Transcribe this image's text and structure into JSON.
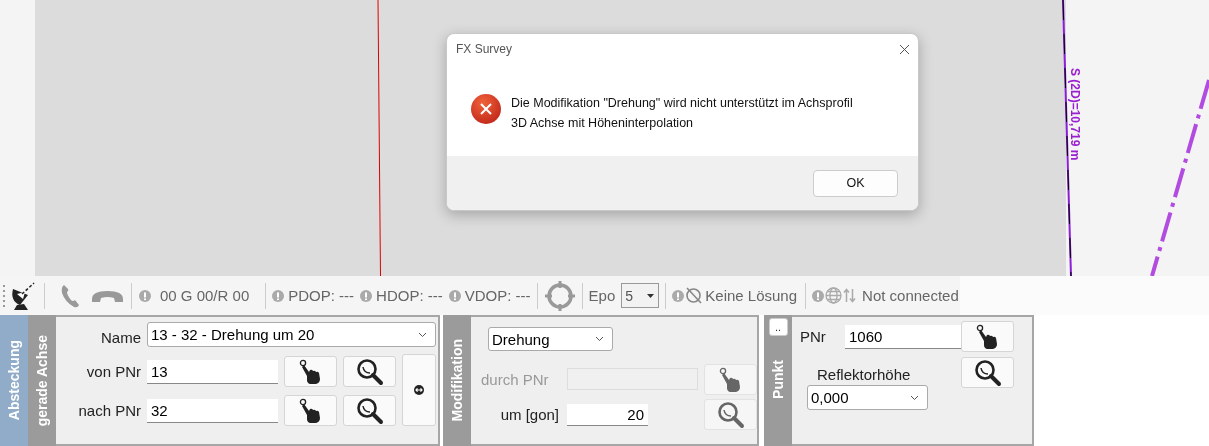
{
  "map": {
    "measure_label": "S (2D)=10,719 m"
  },
  "dialog": {
    "title": "FX Survey",
    "message": "Die Modifikation \"Drehung\" wird nicht unterstützt im Achsprofil\n3D Achse mit Höheninterpolation",
    "buttons": [
      "OK"
    ]
  },
  "toolbar": {
    "satellites": "00  G 00/R 00",
    "dop": [
      {
        "label": "PDOP: ---"
      },
      {
        "label": "HDOP: ---"
      },
      {
        "label": "VDOP: ---"
      }
    ],
    "epoch_label": "Epo",
    "epoch_value": "5",
    "solution": "Keine Lösung",
    "connection": "Not connected"
  },
  "stakeout": {
    "section": "Absteckung",
    "tab": "gerade Achse",
    "name_label": "Name",
    "name_value": "13 - 32 - Drehung um 20",
    "from_label": "von PNr",
    "from_value": "13",
    "to_label": "nach PNr",
    "to_value": "32"
  },
  "modification": {
    "tab": "Modifikation",
    "type": "Drehung",
    "through_label": "durch PNr",
    "through_disabled": true,
    "angle_label": "um [gon]",
    "angle_value": "20"
  },
  "point": {
    "expand_button": "..",
    "tab": "Punkt",
    "pnr_label": "PNr",
    "pnr_value": "1060",
    "height_label": "Reflektorhöhe",
    "height_value": "0,000"
  }
}
